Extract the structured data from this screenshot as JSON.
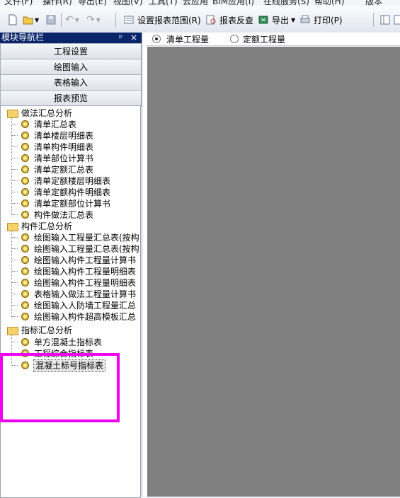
{
  "menubar": {
    "items": [
      "文件(F)",
      "操作(R)",
      "导出(E)",
      "视图(V)",
      "工具(T)",
      "云应用",
      "BIM应用(I)",
      "在线服务(S)",
      "帮助(H)",
      "版本"
    ]
  },
  "toolbar": {
    "set_range_label": "设置报表范围(R)",
    "report_check_label": "报表反查",
    "export_label": "导出",
    "print_label": "打印(P)"
  },
  "nav": {
    "title": "模块导航栏",
    "pin_glyph": "ᵖ",
    "close_glyph": "×",
    "buttons": [
      "工程设置",
      "绘图输入",
      "表格输入",
      "报表预览"
    ]
  },
  "tree": {
    "groups": [
      {
        "label": "做法汇总分析",
        "items": [
          "清单汇总表",
          "清单楼层明细表",
          "清单构件明细表",
          "清单部位计算书",
          "清单定额汇总表",
          "清单定额楼层明细表",
          "清单定额构件明细表",
          "清单定额部位计算书",
          "构件做法汇总表"
        ]
      },
      {
        "label": "构件汇总分析",
        "items": [
          "绘图输入工程量汇总表(按构",
          "绘图输入工程量汇总表(按构",
          "绘图输入构件工程量计算书",
          "绘图输入构件工程量明细表",
          "绘图输入构件工程量明细表",
          "表格输入做法工程量计算书",
          "绘图输入人防墙工程量汇总",
          "绘图输入构件超高模板汇总"
        ]
      },
      {
        "label": "指标汇总分析",
        "items": [
          "单方混凝土指标表",
          "工程综合指标表",
          "混凝土标号指标表"
        ]
      }
    ],
    "selected": "混凝土标号指标表"
  },
  "view_tabs": {
    "options": [
      "清单工程量",
      "定额工程量"
    ],
    "selected": "清单工程量"
  },
  "colors": {
    "highlight": "#f000f0",
    "content_bg": "#808080",
    "nav_title_bg": "#0a246a"
  }
}
